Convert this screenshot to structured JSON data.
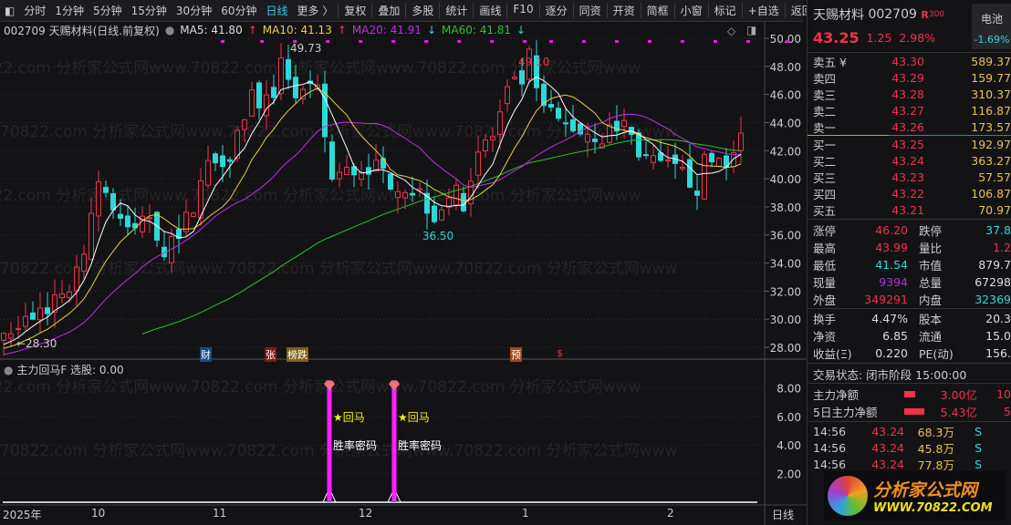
{
  "toolbar": {
    "items": [
      "分时",
      "1分钟",
      "5分钟",
      "15分钟",
      "30分钟",
      "60分钟",
      "日线",
      "更多 〉"
    ],
    "buttons": [
      "复权",
      "叠加",
      "多股",
      "统计",
      "画线",
      "F10",
      "逐分",
      "同资",
      "开资",
      "简框",
      "小窗",
      "标记",
      "+自选",
      "返回"
    ],
    "active": "日线"
  },
  "info": {
    "title": "002709 天赐材料(日线.前复权)",
    "ma5": "MA5: 41.80",
    "ma10": "MA10: 41.13",
    "ma20": "MA20: 41.91",
    "ma60": "MA60: 41.81"
  },
  "colors": {
    "up": "#f0334a",
    "down": "#2ed8d8",
    "ma5": "#ffffff",
    "ma10": "#e8d040",
    "ma20": "#c030e0",
    "ma60": "#30c030",
    "signal": "#ff20ff"
  },
  "price_axis": [
    "50.00",
    "48.00",
    "46.00",
    "44.00",
    "42.00",
    "40.00",
    "38.00",
    "36.00",
    "34.00",
    "32.00",
    "30.00",
    "28.00"
  ],
  "annotations": {
    "high": "49.73",
    "high2": "49.10",
    "low": "36.50",
    "start": "28.30"
  },
  "price_path": [
    [
      0,
      29
    ],
    [
      5,
      30.5
    ],
    [
      10,
      33
    ],
    [
      13,
      40
    ],
    [
      17,
      36
    ],
    [
      20,
      37.5
    ],
    [
      22,
      35
    ],
    [
      25,
      37
    ],
    [
      28,
      41
    ],
    [
      31,
      42
    ],
    [
      34,
      46
    ],
    [
      37,
      45
    ],
    [
      38,
      49
    ],
    [
      40,
      46
    ],
    [
      43,
      46
    ],
    [
      44,
      43
    ],
    [
      45,
      40
    ],
    [
      50,
      41
    ],
    [
      53,
      40
    ],
    [
      57,
      39
    ],
    [
      59,
      37.5
    ],
    [
      61,
      39
    ],
    [
      63,
      38.5
    ],
    [
      65,
      42
    ],
    [
      67,
      43
    ],
    [
      69,
      46
    ],
    [
      71,
      47
    ],
    [
      72,
      48.5
    ],
    [
      73,
      46
    ],
    [
      74,
      45
    ],
    [
      76,
      44
    ],
    [
      79,
      43.5
    ],
    [
      82,
      43
    ],
    [
      85,
      44
    ],
    [
      87,
      42
    ],
    [
      89,
      41
    ],
    [
      92,
      40.5
    ],
    [
      94,
      40
    ],
    [
      95,
      39.5
    ],
    [
      96,
      41
    ],
    [
      98,
      41.5
    ],
    [
      100,
      41.5
    ],
    [
      101,
      43.25
    ]
  ],
  "event_markers": [
    {
      "label": "财",
      "bg": "#1a4a80"
    },
    {
      "label": "张",
      "bg": "#801818"
    },
    {
      "label": "榜跌",
      "bg": "#806018"
    },
    {
      "label": "预",
      "bg": "#a04810"
    },
    {
      "label": "$",
      "bg": "transparent"
    }
  ],
  "indicator": {
    "title": "主力回马F",
    "value": "选股: 0.00",
    "axis": [
      "8.00",
      "6.00",
      "4.00",
      "2.00"
    ],
    "signal_label": "★回马",
    "signal_sub": "胜率密码",
    "signals": [
      {
        "index": 44,
        "value": 8
      },
      {
        "index": 53,
        "value": 8
      }
    ]
  },
  "time_axis": [
    "2025年",
    "10",
    "11",
    "12",
    "1",
    "2"
  ],
  "period": "日线",
  "quote": {
    "name": "天赐材料",
    "code": "002709",
    "tag": "R",
    "tag2": "300",
    "price": "43.25",
    "change": "1.25",
    "pct": "2.98%",
    "sector": "电池",
    "sector_pct": "-1.69%",
    "asks": [
      [
        "卖五 ¥",
        "43.30",
        "589.37"
      ],
      [
        "卖四",
        "43.29",
        "159.77"
      ],
      [
        "卖三",
        "43.28",
        "310.37"
      ],
      [
        "卖二",
        "43.27",
        "116.87"
      ],
      [
        "卖一",
        "43.26",
        "173.57"
      ]
    ],
    "bids": [
      [
        "买一",
        "43.25",
        "192.97"
      ],
      [
        "买二",
        "43.24",
        "363.27"
      ],
      [
        "买三",
        "43.23",
        "57.57"
      ],
      [
        "买四",
        "43.22",
        "106.87"
      ],
      [
        "买五",
        "43.21",
        "70.97"
      ]
    ],
    "stats": [
      [
        "涨停",
        "46.20",
        "跌停",
        "37.8"
      ],
      [
        "最高",
        "43.99",
        "量比",
        "1.2"
      ],
      [
        "最低",
        "41.54",
        "市值",
        "879.7"
      ],
      [
        "现量",
        "9394",
        "总量",
        "67298"
      ],
      [
        "外盘",
        "349291",
        "内盘",
        "32369"
      ]
    ],
    "stats2": [
      [
        "换手",
        "4.47%",
        "股本",
        "20.3"
      ],
      [
        "净资",
        "6.85",
        "流通",
        "15.0"
      ],
      [
        "收益(Ξ)",
        "0.220",
        "PE(动)",
        "156."
      ]
    ],
    "status": "交易状态: 闭市阶段 15:00:00",
    "flows": [
      [
        "主力净额",
        "3.00亿",
        "10"
      ],
      [
        "5日主力净额",
        "5.43亿",
        "5"
      ]
    ],
    "ticks": [
      [
        "14:56",
        "43.24",
        "68.3万",
        "S"
      ],
      [
        "14:56",
        "43.24",
        "45.8万",
        "S"
      ],
      [
        "14:56",
        "43.24",
        "77.8万",
        "S"
      ]
    ]
  },
  "logo": {
    "text": "分析家公式网",
    "url": "WWW.70822.COM"
  }
}
